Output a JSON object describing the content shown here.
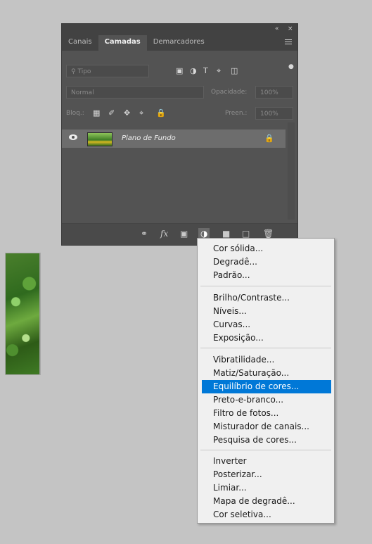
{
  "panel": {
    "tabs": [
      {
        "label": "Canais",
        "active": false
      },
      {
        "label": "Camadas",
        "active": true
      },
      {
        "label": "Demarcadores",
        "active": false
      }
    ],
    "title_controls": {
      "collapse": "«",
      "close": "×"
    },
    "filter": {
      "placeholder": "Tipo"
    },
    "blend_mode": "Normal",
    "opacity_label": "Opacidade:",
    "opacity_value": "100%",
    "lock_label": "Bloq.:",
    "fill_label": "Preen.:",
    "fill_value": "100%",
    "layer": {
      "name": "Plano de Fundo",
      "visible": true,
      "locked": true
    }
  },
  "menu": {
    "items": [
      {
        "label": "Cor sólida..."
      },
      {
        "label": "Degradê..."
      },
      {
        "label": "Padrão..."
      },
      {
        "label": "Brilho/Contraste..."
      },
      {
        "label": "Níveis..."
      },
      {
        "label": "Curvas..."
      },
      {
        "label": "Exposição..."
      },
      {
        "label": "Vibratilidade..."
      },
      {
        "label": "Matiz/Saturação..."
      },
      {
        "label": "Equilíbrio de cores...",
        "highlighted": true
      },
      {
        "label": "Preto-e-branco..."
      },
      {
        "label": "Filtro de fotos..."
      },
      {
        "label": "Misturador de canais..."
      },
      {
        "label": "Pesquisa de cores..."
      },
      {
        "label": "Inverter"
      },
      {
        "label": "Posterizar..."
      },
      {
        "label": "Limiar..."
      },
      {
        "label": "Mapa de degradê..."
      },
      {
        "label": "Cor seletiva..."
      }
    ]
  },
  "colors": {
    "highlight": "#0078d7",
    "panel_bg": "#535353",
    "menu_bg": "#f0f0f0"
  }
}
